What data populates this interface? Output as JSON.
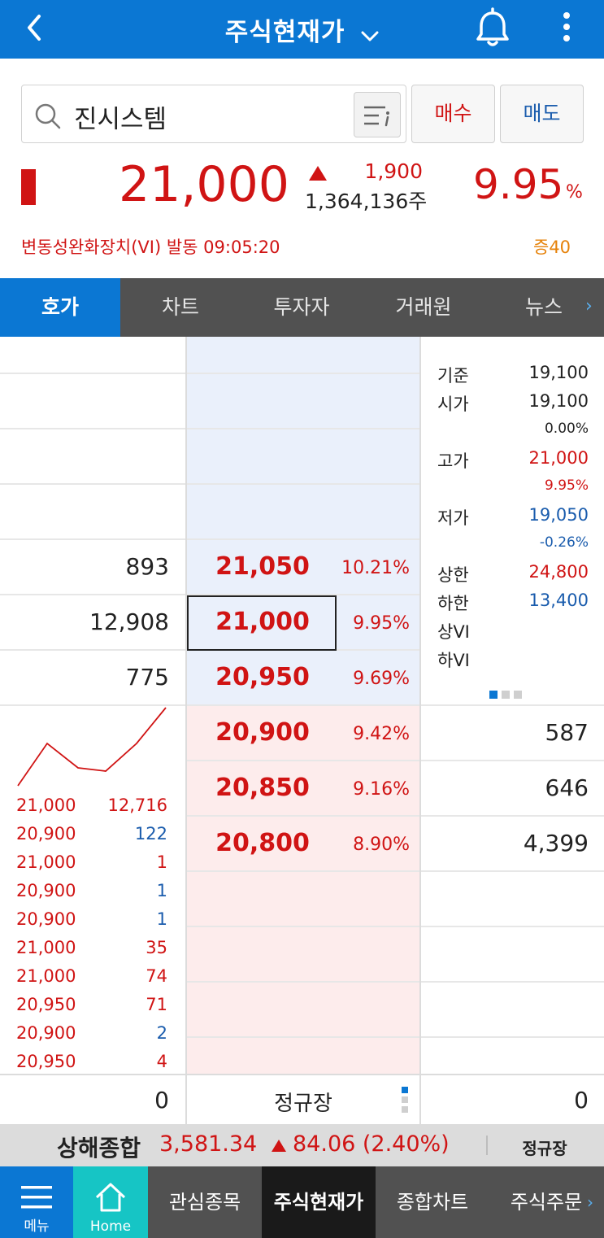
{
  "header": {
    "title": "주식현재가"
  },
  "search": {
    "stock_name": "진시스템",
    "buy_label": "매수",
    "sell_label": "매도"
  },
  "quote": {
    "price": "21,000",
    "change": "1,900",
    "volume": "1,364,136주",
    "change_pct": "9.95",
    "pct_sign": "%",
    "vi_notice": "변동성완화장치(VI) 발동 09:05:20",
    "margin": "증40"
  },
  "tabs": [
    "호가",
    "차트",
    "투자자",
    "거래원",
    "뉴스"
  ],
  "orderbook": {
    "asks": [
      {
        "qty": "893",
        "price": "21,050",
        "pct": "10.21%"
      },
      {
        "qty": "12,908",
        "price": "21,000",
        "pct": "9.95%"
      },
      {
        "qty": "775",
        "price": "20,950",
        "pct": "9.69%"
      }
    ],
    "bids": [
      {
        "qty": "587",
        "price": "20,900",
        "pct": "9.42%"
      },
      {
        "qty": "646",
        "price": "20,850",
        "pct": "9.16%"
      },
      {
        "qty": "4,399",
        "price": "20,800",
        "pct": "8.90%"
      }
    ]
  },
  "info": {
    "base_label": "기준",
    "base": "19,100",
    "open_label": "시가",
    "open": "19,100",
    "open_pct": "0.00%",
    "high_label": "고가",
    "high": "21,000",
    "high_pct": "9.95%",
    "low_label": "저가",
    "low": "19,050",
    "low_pct": "-0.26%",
    "upper_label": "상한",
    "upper": "24,800",
    "lower_label": "하한",
    "lower": "13,400",
    "upper_vi_label": "상VI",
    "lower_vi_label": "하VI"
  },
  "ticks": [
    {
      "price": "21,000",
      "qty": "12,716",
      "color": "#d01414"
    },
    {
      "price": "20,900",
      "qty": "122",
      "color": "#1a5cad"
    },
    {
      "price": "21,000",
      "qty": "1",
      "color": "#d01414"
    },
    {
      "price": "20,900",
      "qty": "1",
      "color": "#1a5cad"
    },
    {
      "price": "20,900",
      "qty": "1",
      "color": "#1a5cad"
    },
    {
      "price": "21,000",
      "qty": "35",
      "color": "#d01414"
    },
    {
      "price": "21,000",
      "qty": "74",
      "color": "#d01414"
    },
    {
      "price": "20,950",
      "qty": "71",
      "color": "#d01414"
    },
    {
      "price": "20,900",
      "qty": "2",
      "color": "#1a5cad"
    },
    {
      "price": "20,950",
      "qty": "4",
      "color": "#d01414"
    }
  ],
  "totals": {
    "ask_total": "0",
    "session": "정규장",
    "bid_total": "0"
  },
  "index_bar": {
    "name": "상해종합",
    "value": "3,581.34",
    "change": "84.06 (2.40%)",
    "session": "정규장"
  },
  "bottom_nav": {
    "menu": "메뉴",
    "home": "Home",
    "items": [
      "관심종목",
      "주식현재가",
      "종합차트",
      "주식주문"
    ]
  },
  "colors": {
    "brand": "#0b77d3",
    "up": "#d01414",
    "down": "#1a5cad",
    "home": "#16c5c5"
  }
}
